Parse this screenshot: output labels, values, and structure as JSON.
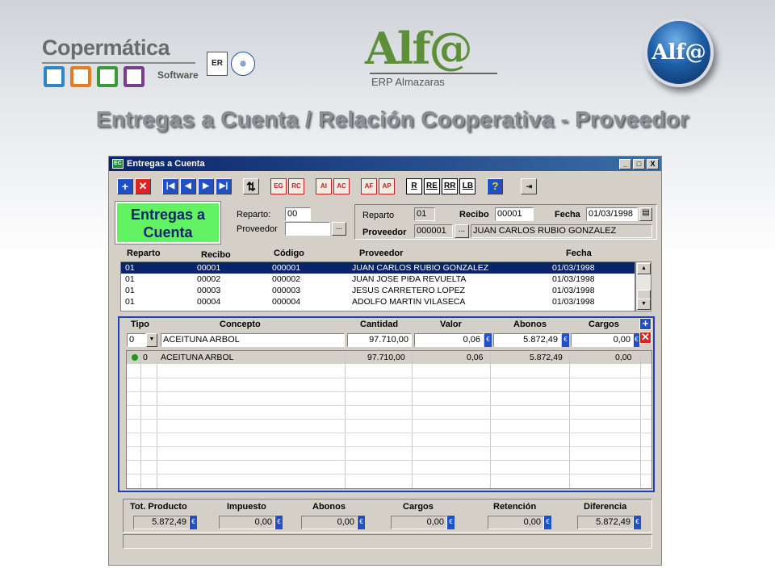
{
  "branding": {
    "company": "Copermática",
    "company_sub": "Software",
    "product": "Alf@",
    "product_sub": "ERP Almazaras",
    "orb_text": "Alf@",
    "colors": {
      "blue": "#2e86c8",
      "orange": "#e77b23",
      "green": "#3a9a3a",
      "purple": "#7a3d8c",
      "alf_green": "#5d8f3a"
    }
  },
  "slide_title": "Entregas a Cuenta / Relación Cooperativa - Proveedor",
  "window": {
    "title": "Entregas a Cuenta",
    "app_icon": "app-icon",
    "controls": [
      "_",
      "□",
      "X"
    ]
  },
  "toolbar": {
    "add": "+",
    "delete": "✕",
    "first": "|◀",
    "prev": "◀",
    "next": "▶",
    "last": "▶|",
    "swap": "⇅",
    "eg": "EG",
    "rc": "RC",
    "ai": "AI",
    "ac": "AC",
    "af": "AF",
    "ap": "AP",
    "r": "R",
    "re": "RE",
    "rr": "RR",
    "lb": "LB",
    "help": "?",
    "exit": "⇥"
  },
  "form": {
    "green_label_line1": "Entregas a",
    "green_label_line2": "Cuenta",
    "reparto_label": "Reparto:",
    "reparto_value": "00",
    "proveedor_label": "Proveedor",
    "proveedor_value": "",
    "lookup": "...",
    "info": {
      "reparto_label": "Reparto",
      "reparto_value": "01",
      "recibo_label": "Recibo",
      "recibo_value": "00001",
      "fecha_label": "Fecha",
      "fecha_value": "01/03/1998",
      "proveedor_label": "Proveedor",
      "proveedor_code": "000001",
      "proveedor_name": "JUAN CARLOS RUBIO GONZALEZ"
    }
  },
  "list": {
    "headers": [
      "Reparto",
      "Recibo",
      "Código",
      "Proveedor",
      "Fecha"
    ],
    "rows": [
      [
        "01",
        "00001",
        "000001",
        "JUAN CARLOS RUBIO GONZALEZ",
        "01/03/1998"
      ],
      [
        "01",
        "00002",
        "000002",
        "JUAN JOSE PIÐA REVUELTA",
        "01/03/1998"
      ],
      [
        "01",
        "00003",
        "000003",
        "JESUS CARRETERO LOPEZ",
        "01/03/1998"
      ],
      [
        "01",
        "00004",
        "000004",
        "ADOLFO MARTIN VILASECA",
        "01/03/1998"
      ]
    ]
  },
  "detail": {
    "headers": [
      "Tipo",
      "Concepto",
      "Cantidad",
      "Valor",
      "Abonos",
      "Cargos"
    ],
    "edit": {
      "tipo": "0",
      "concepto": "ACEITUNA ARBOL",
      "cantidad": "97.710,00",
      "valor": "0,06",
      "abonos": "5.872,49",
      "cargos": "0,00"
    },
    "rows": [
      [
        "0",
        "ACEITUNA ARBOL",
        "97.710,00",
        "0,06",
        "5.872,49",
        "0,00"
      ]
    ],
    "currency_icon": "€",
    "add_btn": "+",
    "del_btn": "✕"
  },
  "totals": {
    "headers": [
      "Tot. Producto",
      "Impuesto",
      "Abonos",
      "Cargos",
      "Retención",
      "Diferencia"
    ],
    "values": [
      "5.872,49",
      "0,00",
      "0,00",
      "0,00",
      "0,00",
      "5.872,49"
    ]
  }
}
